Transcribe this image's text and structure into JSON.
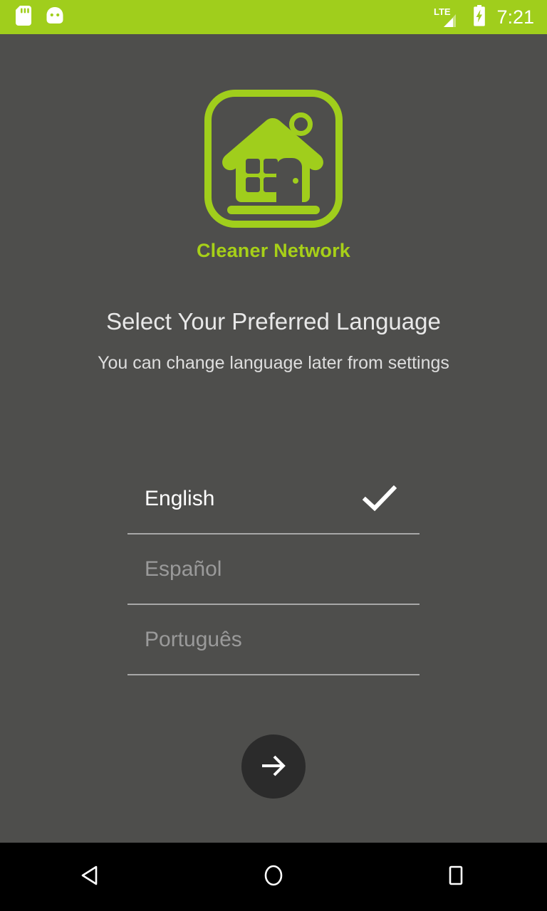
{
  "status_bar": {
    "background_color": "#a0ce1c",
    "left_icons": [
      {
        "name": "sd-card-icon",
        "glyph": "sd-card"
      },
      {
        "name": "android-head-icon",
        "glyph": "android-head"
      }
    ],
    "network_label": "LTE",
    "signal_icon": "signal-bars-icon",
    "battery_icon": "battery-charging-icon",
    "time": "7:21"
  },
  "logo": {
    "frame_icon": "app-logo-frame",
    "house_icon": "house-icon",
    "brand_name": "Cleaner Network",
    "brand_color": "#a7d018"
  },
  "headings": {
    "title": "Select Your Preferred Language",
    "subtitle": "You can change language later from settings"
  },
  "languages": {
    "selected_index": 0,
    "check_icon": "check-icon",
    "items": [
      {
        "label": "English",
        "selected": true
      },
      {
        "label": "Español",
        "selected": false
      },
      {
        "label": "Português",
        "selected": false
      }
    ]
  },
  "next_button": {
    "icon": "arrow-right-icon",
    "background_color": "#2b2b2b"
  },
  "nav_bar": {
    "background_color": "#000000",
    "items": [
      {
        "name": "nav-back-button",
        "icon": "triangle-back-icon"
      },
      {
        "name": "nav-home-button",
        "icon": "circle-home-icon"
      },
      {
        "name": "nav-recents-button",
        "icon": "square-recents-icon"
      }
    ]
  },
  "theme": {
    "background_color": "#4e4e4c",
    "accent_color": "#a0ce1c"
  }
}
